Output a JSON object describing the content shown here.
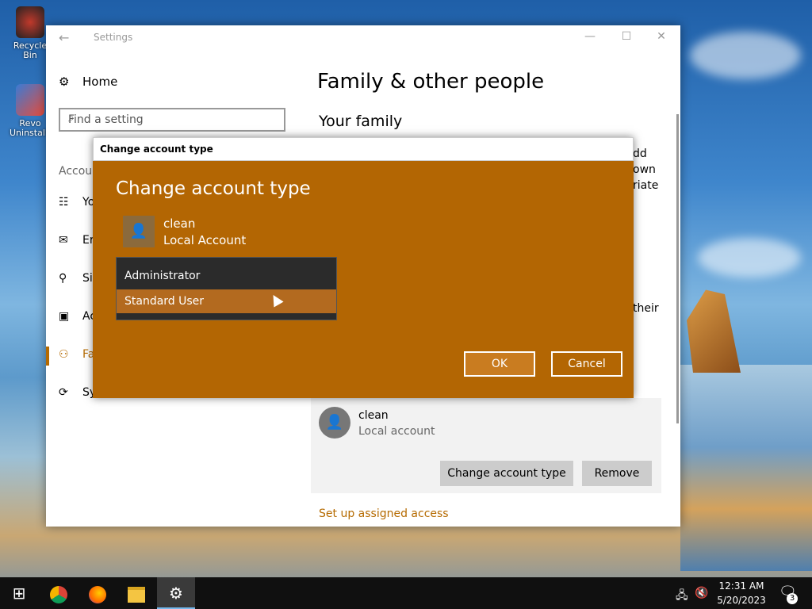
{
  "desktop": {
    "icons": [
      {
        "label": "Recycle Bin",
        "icon": "recycle-bin-icon"
      },
      {
        "label": "Revo Uninstaller",
        "icon": "revo-uninstaller-icon"
      }
    ]
  },
  "settings_window": {
    "title": "Settings",
    "nav": {
      "home": "Home",
      "search_placeholder": "Find a setting",
      "section": "Accou",
      "items": [
        {
          "label": "Yo",
          "icon": "user-info-icon"
        },
        {
          "label": "Er",
          "icon": "email-icon"
        },
        {
          "label": "Si",
          "icon": "key-icon"
        },
        {
          "label": "Ac",
          "icon": "briefcase-icon"
        },
        {
          "label": "Fa",
          "icon": "family-icon",
          "active": true
        },
        {
          "label": "Sy",
          "icon": "sync-icon"
        }
      ]
    },
    "page_title": "Family & other people",
    "your_family": "Your family",
    "side_text": [
      "dd",
      "own",
      "riate",
      "their"
    ],
    "account": {
      "name": "clean",
      "type": "Local account",
      "change_button": "Change account type",
      "remove_button": "Remove"
    },
    "assigned_access_link": "Set up assigned access"
  },
  "dialog": {
    "window_title": "Change account type",
    "heading": "Change account type",
    "user_name": "clean",
    "user_type": "Local Account",
    "options": [
      "Administrator",
      "Standard User"
    ],
    "hovered_option": "Standard User",
    "ok_label": "OK",
    "cancel_label": "Cancel"
  },
  "taskbar": {
    "apps": [
      "start-icon",
      "chrome-icon",
      "firefox-icon",
      "file-explorer-icon",
      "settings-gear-icon"
    ],
    "time": "12:31 AM",
    "date": "5/20/2023",
    "notification_count": "3"
  },
  "colors": {
    "accent": "#b36603",
    "accent_hover": "#b36a1f",
    "dropdown_bg": "#2b2b2b"
  }
}
